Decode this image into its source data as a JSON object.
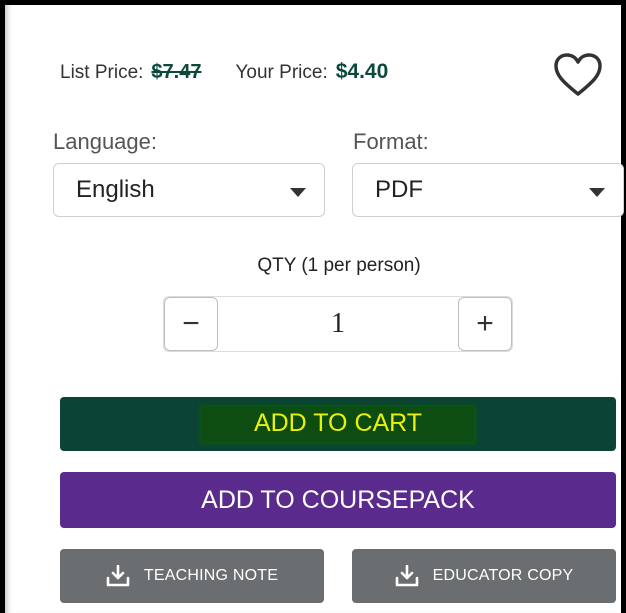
{
  "price": {
    "list_label": "List Price:",
    "list_value": "$7.47",
    "your_label": "Your Price:",
    "your_value": "$4.40"
  },
  "favorite": {
    "icon": "heart-icon"
  },
  "language": {
    "label": "Language:",
    "value": "English"
  },
  "format": {
    "label": "Format:",
    "value": "PDF"
  },
  "quantity": {
    "label": "QTY (1 per person)",
    "minus": "−",
    "value": "1",
    "plus": "+"
  },
  "actions": {
    "add_to_cart": "ADD TO CART",
    "add_to_coursepack": "ADD TO COURSEPACK",
    "teaching_note": "TEACHING NOTE",
    "educator_copy": "EDUCATOR COPY"
  },
  "colors": {
    "price_green": "#0b4a3b",
    "cart_bg": "#0b4336",
    "cart_highlight_text": "#e9f10a",
    "coursepack_bg": "#5a2b8c",
    "secondary_bg": "#6b6e70"
  }
}
